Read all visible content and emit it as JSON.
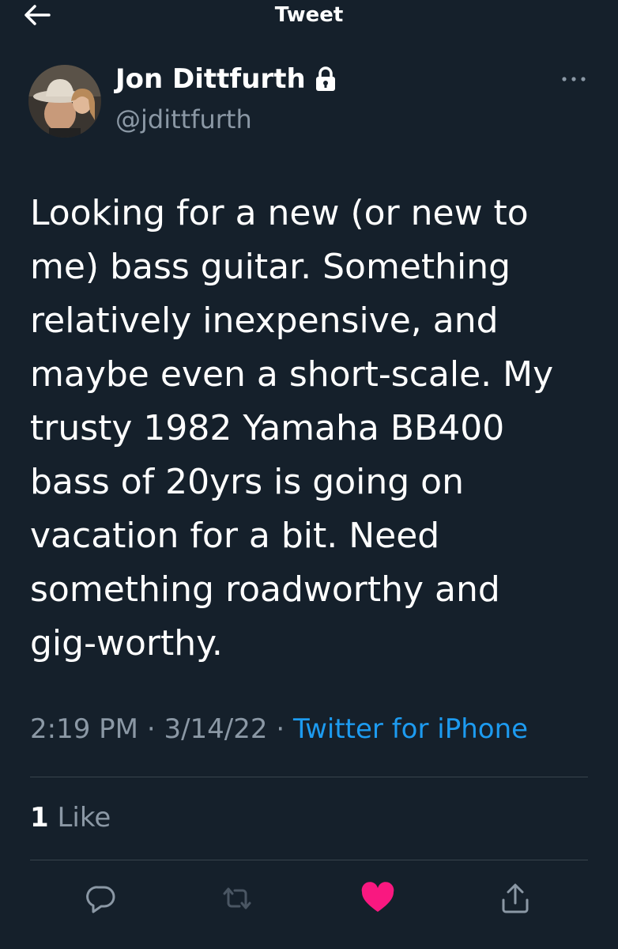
{
  "header": {
    "title": "Tweet"
  },
  "author": {
    "name": "Jon Dittfurth",
    "handle": "@jdittfurth"
  },
  "tweet": {
    "lines": [
      "Looking for a new (or new to",
      "me) bass guitar. Something",
      "relatively inexpensive, and",
      "maybe even a short-scale. My",
      "trusty 1982 Yamaha BB400",
      "bass of 20yrs is going on",
      "vacation for a bit. Need",
      "something roadworthy and",
      "gig-worthy."
    ],
    "time": "2:19 PM",
    "separator": "·",
    "date": "3/14/22",
    "source": "Twitter for iPhone"
  },
  "stats": {
    "likes_count": "1",
    "likes_label": "Like"
  },
  "actions": {
    "reply_icon": "reply-icon",
    "retweet_icon": "retweet-icon",
    "like_icon": "heart-icon",
    "share_icon": "share-icon",
    "like_color": "#f91880"
  },
  "colors": {
    "background": "#15202b",
    "secondary_text": "#8b98a5",
    "accent": "#1d9bf0",
    "divider": "#38444d"
  }
}
